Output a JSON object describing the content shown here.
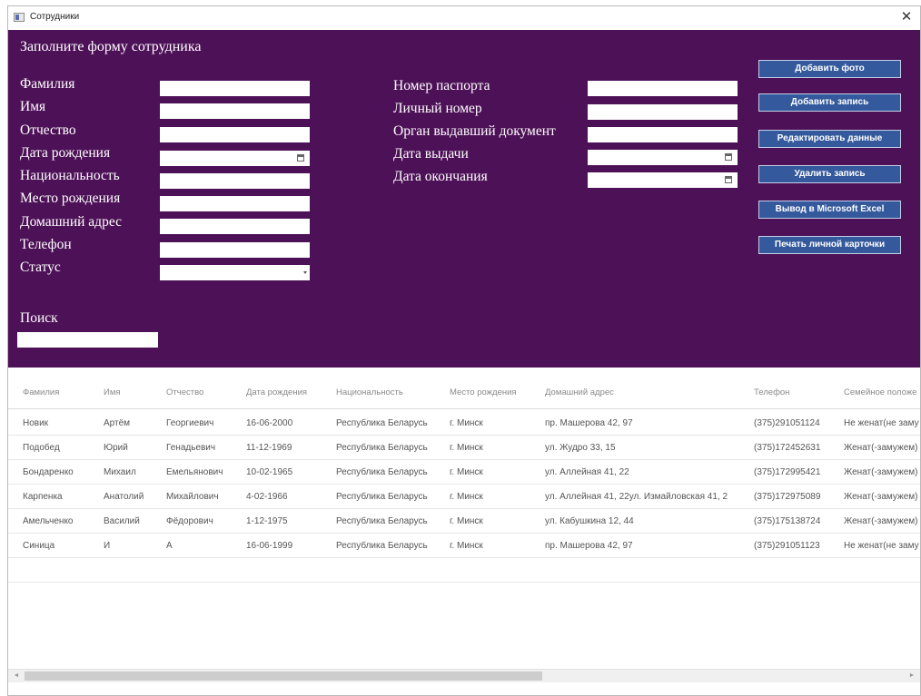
{
  "window": {
    "title": "Сотрудники"
  },
  "form": {
    "title": "Заполните форму сотрудника",
    "labels": {
      "surname": "Фамилия",
      "name": "Имя",
      "patronymic": "Отчество",
      "birthdate": "Дата рождения",
      "nationality": "Национальность",
      "birthplace": "Место рождения",
      "address": "Домашний адрес",
      "phone": "Телефон",
      "status": "Статус",
      "passport": "Номер паспорта",
      "personal_number": "Личный номер",
      "issuer": "Орган выдавший документ",
      "issue_date": "Дата выдачи",
      "expiry_date": "Дата окончания"
    },
    "search_label": "Поиск"
  },
  "buttons": {
    "add_photo": "Добавить фото",
    "add_record": "Добавить запись",
    "edit_data": "Редактировать данные",
    "delete_record": "Удалить запись",
    "export_excel": "Вывод в Microsoft Excel",
    "print_card": "Печать личной карточки"
  },
  "table": {
    "headers": [
      "Фамилия",
      "Имя",
      "Отчество",
      "Дата рождения",
      "Национальность",
      "Место рождения",
      "Домашний адрес",
      "Телефон",
      "Семейное положе"
    ],
    "rows": [
      [
        "Новик",
        "Артём",
        "Георгиевич",
        "16-06-2000",
        "Республика Беларусь",
        "г. Минск",
        "пр. Машерова 42, 97",
        "(375)291051124",
        "Не женат(не заму"
      ],
      [
        "Подобед",
        "Юрий",
        "Генадьевич",
        "11-12-1969",
        "Республика Беларусь",
        "г. Минск",
        "ул. Жудро 33, 15",
        "(375)172452631",
        "Женат(-замужем)"
      ],
      [
        "Бондаренко",
        "Михаил",
        "Емельянович",
        "10-02-1965",
        "Республика Беларусь",
        "г. Минск",
        "ул. Аллейная 41, 22",
        "(375)172995421",
        "Женат(-замужем)"
      ],
      [
        "Карпенка",
        "Анатолий",
        "Михайлович",
        "4-02-1966",
        "Республика Беларусь",
        "г. Минск",
        "ул. Аллейная 41, 22ул. Измайловская 41, 2",
        "(375)172975089",
        "Женат(-замужем)"
      ],
      [
        "Амельченко",
        "Василий",
        "Фёдорович",
        "1-12-1975",
        "Республика Беларусь",
        "г. Минск",
        "ул. Кабушкина 12, 44",
        "(375)175138724",
        "Женат(-замужем)"
      ],
      [
        "Синица",
        "И",
        "А",
        "16-06-1999",
        "Республика Беларусь",
        "г. Минск",
        "пр. Машерова 42, 97",
        "(375)291051123",
        "Не женат(не заму"
      ]
    ]
  },
  "scrollbar": {
    "left_arrow": "◄",
    "right_arrow": "►"
  },
  "colors": {
    "panel": "#4d1157",
    "button": "#34599c"
  }
}
